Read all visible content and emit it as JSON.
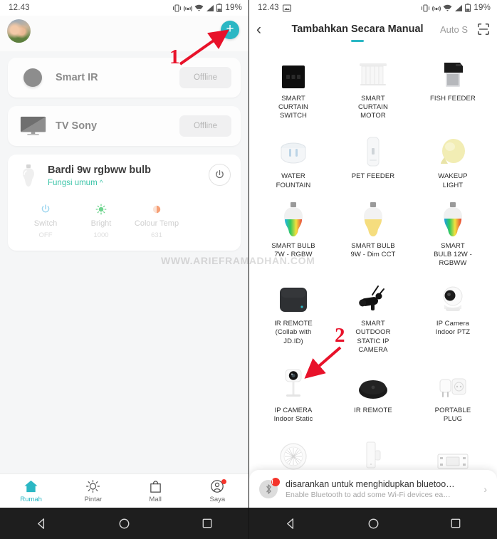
{
  "left": {
    "status": {
      "time": "12.43",
      "battery": "19%"
    },
    "header": {
      "avatar": "user-avatar",
      "add_button": "+"
    },
    "devices": [
      {
        "name": "Smart IR",
        "status": "Offline",
        "icon": "round-ir-icon"
      },
      {
        "name": "TV Sony",
        "status": "Offline",
        "icon": "tv-icon"
      }
    ],
    "bulb": {
      "title": "Bardi 9w rgbww bulb",
      "subtitle": "Fungsi umum",
      "caret": "^",
      "functions": [
        {
          "label": "Switch",
          "value": "OFF",
          "icon": "power-icon",
          "color": "#9dd6ef"
        },
        {
          "label": "Bright",
          "value": "1000",
          "icon": "brightness-icon",
          "color": "#6ed48e"
        },
        {
          "label": "Colour Temp",
          "value": "631",
          "icon": "colour-temp-icon",
          "color": "#f6b79a"
        }
      ]
    },
    "bottom_nav": [
      {
        "label": "Rumah",
        "icon": "home-icon",
        "active": true,
        "badge": false
      },
      {
        "label": "Pintar",
        "icon": "smart-sun-icon",
        "active": false,
        "badge": false
      },
      {
        "label": "Mall",
        "icon": "shopping-bag-icon",
        "active": false,
        "badge": false
      },
      {
        "label": "Saya",
        "icon": "profile-icon",
        "active": false,
        "badge": true
      }
    ]
  },
  "right": {
    "status": {
      "time": "12.43",
      "battery": "19%"
    },
    "header": {
      "back": "‹",
      "title": "Tambahkan Secara Manual",
      "auto_scan": "Auto S",
      "scan_icon": "qr-scan-icon"
    },
    "grid": [
      {
        "label": "SMART\nCURTAIN\nSWITCH",
        "icon": "curtain-switch-icon"
      },
      {
        "label": "SMART\nCURTAIN\nMOTOR",
        "icon": "curtain-motor-icon"
      },
      {
        "label": "FISH FEEDER",
        "icon": "fish-feeder-icon"
      },
      {
        "label": "WATER\nFOUNTAIN",
        "icon": "water-fountain-icon"
      },
      {
        "label": "PET FEEDER",
        "icon": "pet-feeder-icon"
      },
      {
        "label": "WAKEUP\nLIGHT",
        "icon": "wakeup-light-icon"
      },
      {
        "label": "SMART BULB\n7W - RGBW",
        "icon": "smart-bulb-rgbw-icon"
      },
      {
        "label": "SMART BULB\n9W - Dim CCT",
        "icon": "smart-bulb-cct-icon"
      },
      {
        "label": "SMART\nBULB 12W -\nRGBWW",
        "icon": "smart-bulb-rgbww-icon"
      },
      {
        "label": "IR REMOTE\n(Collab with\nJD.ID)",
        "icon": "ir-remote-square-icon"
      },
      {
        "label": "SMART\nOUTDOOR\nSTATIC IP\nCAMERA",
        "icon": "outdoor-camera-icon"
      },
      {
        "label": "IP Camera\nIndoor PTZ",
        "icon": "ptz-camera-icon"
      },
      {
        "label": "IP CAMERA\nIndoor Static",
        "icon": "indoor-static-camera-icon"
      },
      {
        "label": "IR REMOTE",
        "icon": "ir-remote-round-icon"
      },
      {
        "label": "PORTABLE\nPLUG",
        "icon": "portable-plug-icon"
      },
      {
        "label": "",
        "icon": "siren-icon"
      },
      {
        "label": "",
        "icon": "door-sensor-icon"
      },
      {
        "label": "",
        "icon": "relay-module-icon"
      }
    ],
    "bluetooth_sheet": {
      "title": "disarankan untuk menghidupkan bluetoo…",
      "subtitle": "Enable Bluetooth to add some Wi-Fi devices ea…",
      "badge": "!",
      "arrow": "›"
    }
  },
  "annotations": [
    {
      "number": "1",
      "target": "add-device-fab"
    },
    {
      "number": "2",
      "target": "ip-camera-indoor-static"
    }
  ],
  "watermark": "WWW.ARIEFRAMADHAN.COM",
  "colors": {
    "accent": "#2bb7c4",
    "annotation": "#e8122a",
    "badge": "#f5342b"
  }
}
